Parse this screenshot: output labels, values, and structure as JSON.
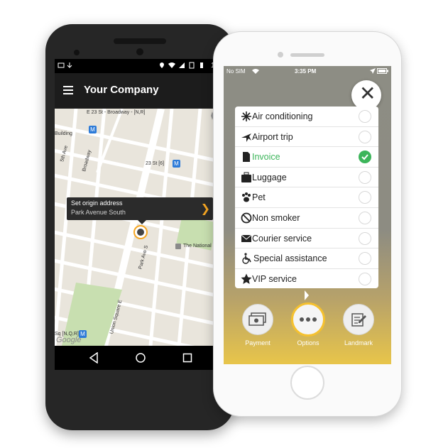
{
  "android": {
    "status_time": "1",
    "toolbar_title": "Your Company",
    "map_labels": {
      "street1": "E 23 St - Broadway - [N,R]",
      "building": "Building",
      "fifth_ave": "5th Ave",
      "broadway": "Broadway",
      "station_23": "23 St [6]",
      "park_ave": "Park Ave S",
      "national": "The National",
      "union_sq": "Union Square E",
      "sq": "Sq [N,Q,R]",
      "google": "Google"
    },
    "callout": {
      "title": "Set origin address",
      "address": "Park Avenue South"
    }
  },
  "iphone": {
    "carrier": "No SIM",
    "time": "3:35 PM",
    "options": [
      {
        "label": "Air conditioning",
        "icon": "snowflake-icon",
        "selected": false
      },
      {
        "label": "Airport trip",
        "icon": "airplane-icon",
        "selected": false
      },
      {
        "label": "Invoice",
        "icon": "document-icon",
        "selected": true
      },
      {
        "label": "Luggage",
        "icon": "luggage-icon",
        "selected": false
      },
      {
        "label": "Pet",
        "icon": "paw-icon",
        "selected": false
      },
      {
        "label": "Non smoker",
        "icon": "no-smoking-icon",
        "selected": false
      },
      {
        "label": "Courier service",
        "icon": "envelope-icon",
        "selected": false
      },
      {
        "label": "Special assistance",
        "icon": "wheelchair-icon",
        "selected": false
      },
      {
        "label": "VIP service",
        "icon": "star-icon",
        "selected": false
      }
    ],
    "bottom_buttons": {
      "payment": "Payment",
      "options": "Options",
      "landmark": "Landmark"
    }
  },
  "colors": {
    "accent": "#f5a623",
    "selected_green": "#3cb55a",
    "active_ring": "#f5c12f"
  }
}
